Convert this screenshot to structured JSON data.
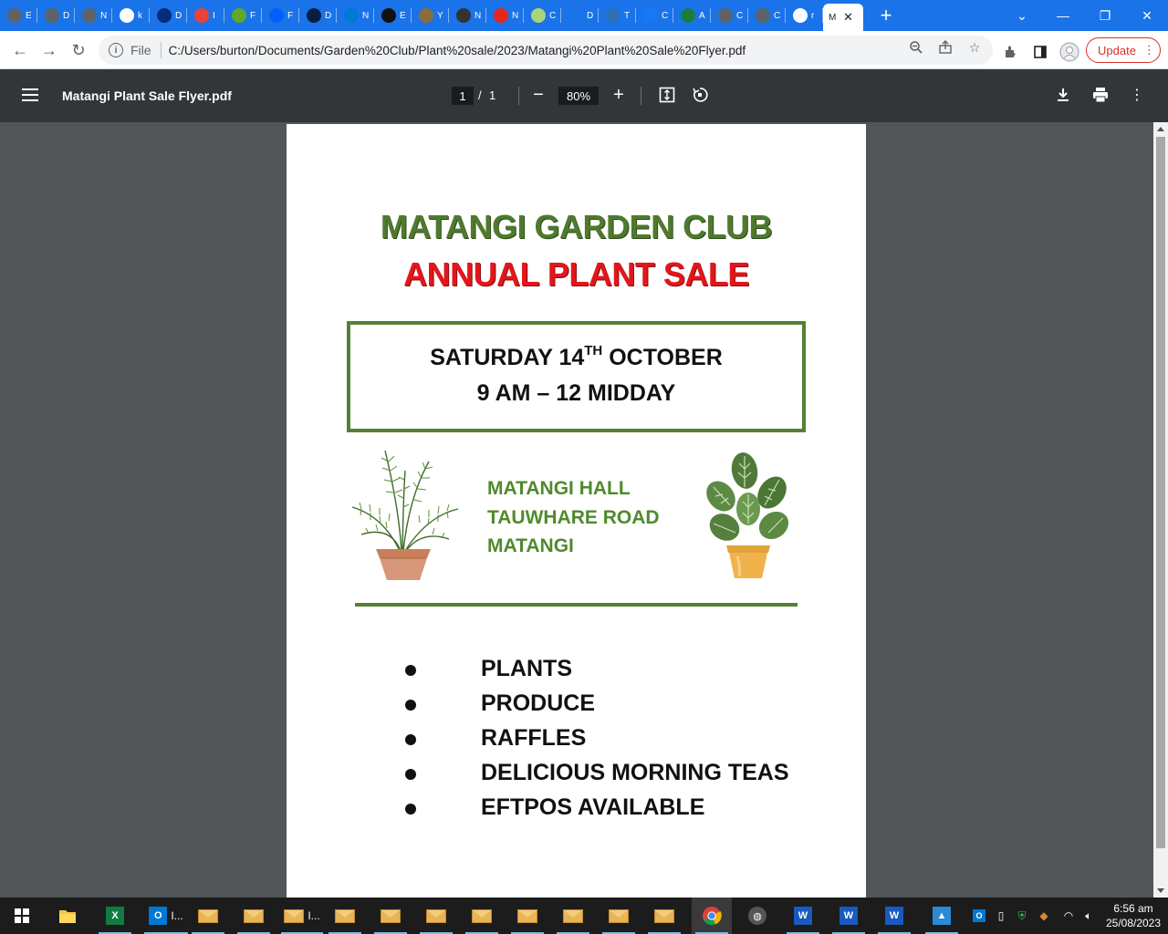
{
  "browser": {
    "tabs": [
      {
        "label": "E",
        "icon": "settings-icon",
        "color": "#5f6368"
      },
      {
        "label": "D",
        "icon": "settings-icon",
        "color": "#5f6368"
      },
      {
        "label": "N",
        "icon": "settings-icon",
        "color": "#5f6368"
      },
      {
        "label": "k",
        "icon": "google-icon",
        "color": "#ffffff"
      },
      {
        "label": "D",
        "icon": "dk-icon",
        "color": "#0a2a7a"
      },
      {
        "label": "I",
        "icon": "gmail-icon",
        "color": "#ea4335"
      },
      {
        "label": "F",
        "icon": "leaf-icon",
        "color": "#5fa829"
      },
      {
        "label": "F",
        "icon": "dropbox-icon",
        "color": "#0061fe"
      },
      {
        "label": "D",
        "icon": "app-icon",
        "color": "#0b1e40"
      },
      {
        "label": "N",
        "icon": "outlook-icon",
        "color": "#0078d4"
      },
      {
        "label": "E",
        "icon": "edge-icon",
        "color": "#111111"
      },
      {
        "label": "Y",
        "icon": "mail-icon",
        "color": "#8a6d3b"
      },
      {
        "label": "N",
        "icon": "mail-icon",
        "color": "#333333"
      },
      {
        "label": "N",
        "icon": "adobe-icon",
        "color": "#e4261c"
      },
      {
        "label": "C",
        "icon": "leaf-icon",
        "color": "#a8d47a"
      },
      {
        "label": "D",
        "icon": "chevron-icon",
        "color": "#1a73e8"
      },
      {
        "label": "T",
        "icon": "image-icon",
        "color": "#2f6fb5"
      },
      {
        "label": "C",
        "icon": "facebook-icon",
        "color": "#1877f2"
      },
      {
        "label": "A",
        "icon": "leaf-icon",
        "color": "#1b7c43"
      },
      {
        "label": "C",
        "icon": "settings-icon",
        "color": "#5f6368"
      },
      {
        "label": "C",
        "icon": "settings-icon",
        "color": "#5f6368"
      },
      {
        "label": "r",
        "icon": "google-icon",
        "color": "#ffffff"
      }
    ],
    "active_tab_label": "M",
    "new_tab_symbol": "+",
    "address": {
      "scheme_label": "File",
      "url": "C:/Users/burton/Documents/Garden%20Club/Plant%20sale/2023/Matangi%20Plant%20Sale%20Flyer.pdf"
    },
    "update_label": "Update"
  },
  "pdf_viewer": {
    "title": "Matangi Plant Sale Flyer.pdf",
    "page_current": "1",
    "page_separator": "/",
    "page_total": "1",
    "zoom": "80%",
    "zoom_out_symbol": "−",
    "zoom_in_symbol": "+"
  },
  "flyer": {
    "heading_1": "MATANGI GARDEN CLUB",
    "heading_2": "ANNUAL PLANT SALE",
    "date_prefix": "SATURDAY 14",
    "date_sup": "TH",
    "date_suffix": " OCTOBER",
    "time": "9 AM – 12 MIDDAY",
    "location": [
      "MATANGI HALL",
      "TAUWHARE ROAD",
      "MATANGI"
    ],
    "items": [
      "PLANTS",
      "PRODUCE",
      "RAFFLES",
      "DELICIOUS MORNING TEAS",
      "EFTPOS AVAILABLE"
    ],
    "colors": {
      "green": "#4f7a2e",
      "red": "#e3161b",
      "border": "#558034"
    }
  },
  "taskbar": {
    "outlook_label": "I...",
    "mail_label": "I...",
    "time": "6:56 am",
    "date": "25/08/2023"
  }
}
